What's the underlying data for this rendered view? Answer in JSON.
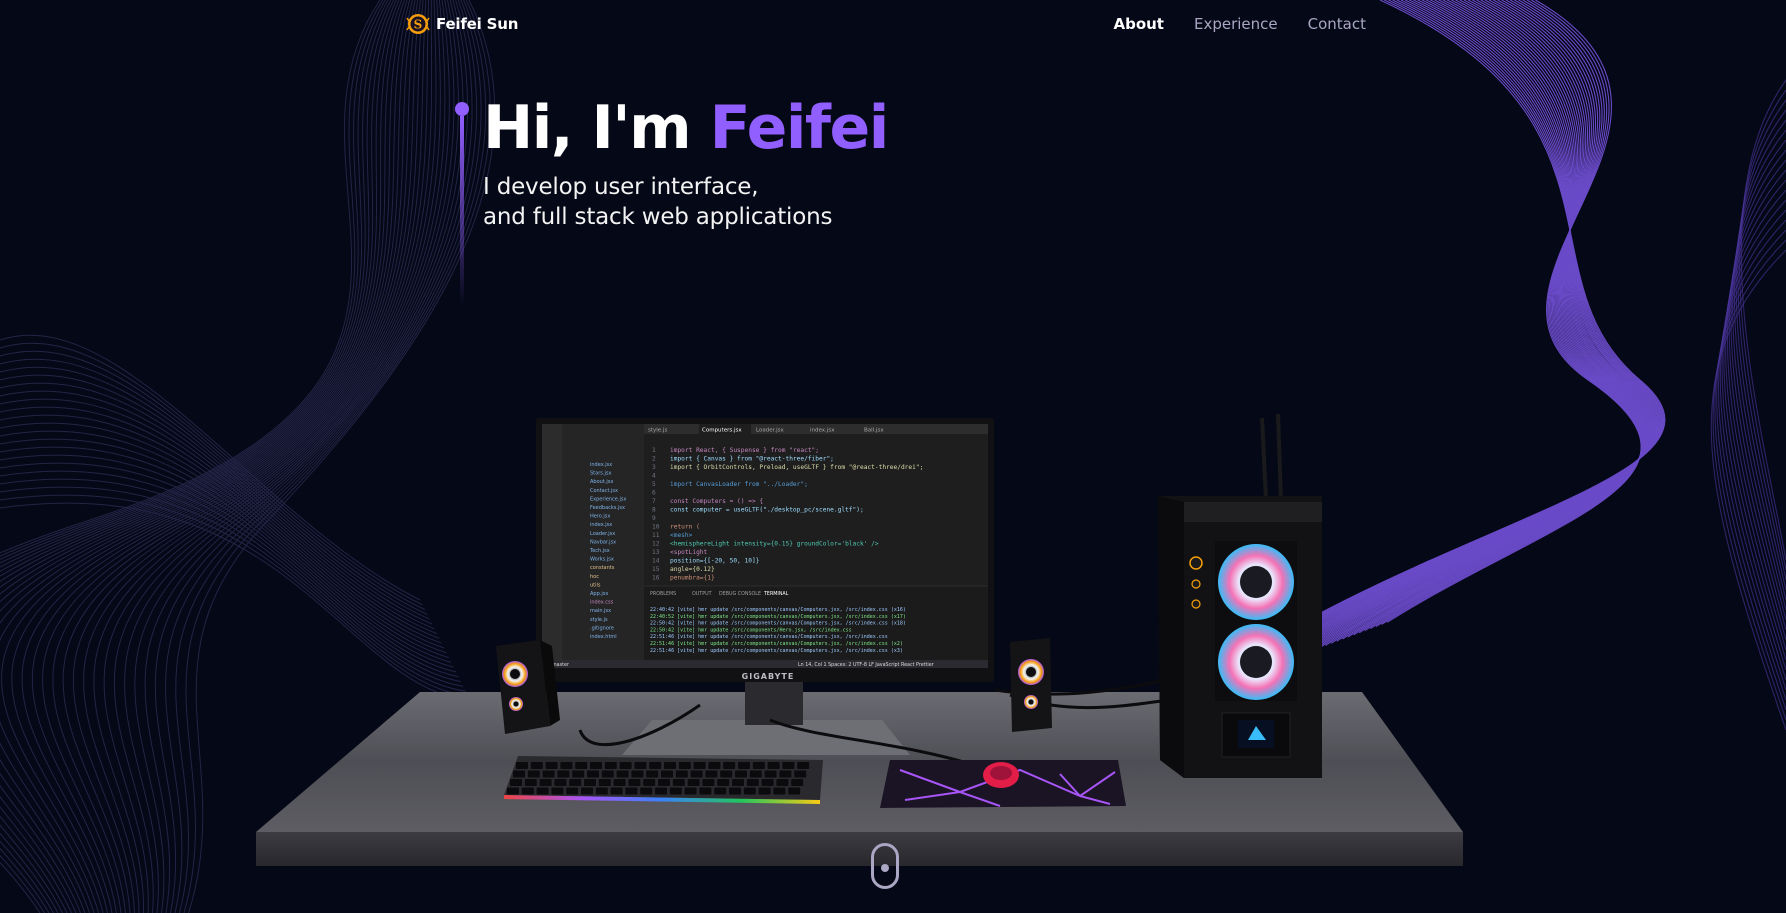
{
  "header": {
    "logo_letter": "S",
    "logo_name": "Feifei Sun",
    "nav": [
      {
        "label": "About",
        "active": true
      },
      {
        "label": "Experience",
        "active": false
      },
      {
        "label": "Contact",
        "active": false
      }
    ]
  },
  "hero": {
    "title_prefix": "Hi, I'm ",
    "title_name": "Feifei",
    "subtitle_line1": "I develop user interface,",
    "subtitle_line2": "and full stack web applications"
  },
  "monitor": {
    "brand": "GIGABYTE",
    "tabs": [
      "style.js",
      "Computers.jsx",
      "Loader.jsx",
      "index.jsx",
      "Ball.jsx"
    ],
    "explorer_files": [
      "index.jsx",
      "Stars.jsx",
      "About.jsx",
      "Contact.jsx",
      "Experience.jsx",
      "Feedbacks.jsx",
      "Hero.jsx",
      "index.jsx",
      "Loader.jsx",
      "Navbar.jsx",
      "Tech.jsx",
      "Works.jsx",
      "constants",
      "hoc",
      "utils",
      "App.jsx",
      "index.css",
      "main.jsx",
      "style.js",
      ".gitignore",
      "index.html"
    ],
    "code_lines": [
      "import React, { Suspense } from \"react\";",
      "import { Canvas } from \"@react-three/fiber\";",
      "import { OrbitControls, Preload, useGLTF } from \"@react-three/drei\";",
      "",
      "import CanvasLoader from \"../Loader\";",
      "",
      "const Computers = () => {",
      "  const computer = useGLTF(\"./desktop_pc/scene.gltf\");",
      "",
      "  return (",
      "    <mesh>",
      "      <hemisphereLight intensity={0.15} groundColor='black' />",
      "      <spotLight",
      "        position={[-20, 50, 10]}",
      "        angle={0.12}",
      "        penumbra={1}"
    ],
    "panel_tabs": [
      "PROBLEMS",
      "OUTPUT",
      "DEBUG CONSOLE",
      "TERMINAL"
    ],
    "terminal_lines": [
      "22:40:42 [vite] hmr update /src/components/canvas/Computers.jsx, /src/index.css (x16)",
      "22:40:52 [vite] hmr update /src/components/canvas/Computers.jsx, /src/index.css (x17)",
      "22:50:42 [vite] hmr update /src/components/canvas/Computers.jsx, /src/index.css (x18)",
      "22:50:42 [vite] hmr update /src/components/Hero.jsx, /src/index.css",
      "22:51:46 [vite] hmr update /src/components/canvas/Computers.jsx, /src/index.css",
      "22:51:46 [vite] hmr update /src/components/canvas/Computers.jsx, /src/index.css (x2)",
      "22:51:46 [vite] hmr update /src/components/canvas/Computers.jsx, /src/index.css (x3)"
    ],
    "status_left": "master",
    "status_right": "Ln 14, Col 1   Spaces: 2   UTF-8   LF   JavaScript React   Prettier"
  },
  "colors": {
    "background": "#050816",
    "accent": "#915eff",
    "secondary_text": "#aaa6c3"
  },
  "icons": {
    "logo": "logo-s-icon",
    "scroll": "scroll-mouse-icon"
  }
}
